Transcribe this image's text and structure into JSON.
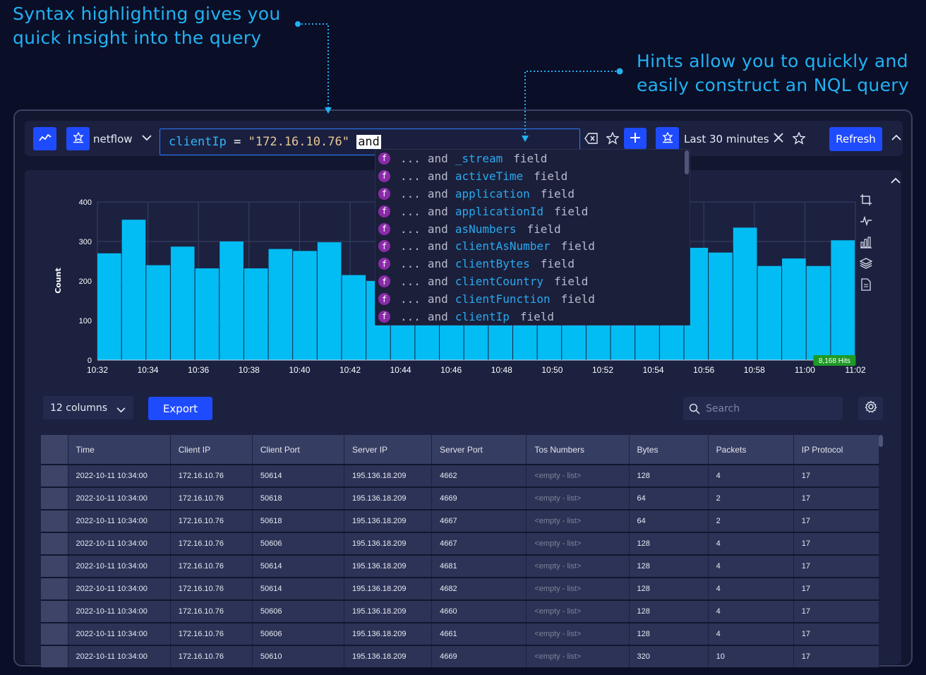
{
  "annotations": {
    "left_line1": "Syntax highlighting gives you",
    "left_line2": "quick insight into the query",
    "right_line1": "Hints allow you to quickly and",
    "right_line2": "easily construct an NQL query"
  },
  "toolbar": {
    "source": "netflow",
    "query": {
      "field": "clientIp",
      "operator": "=",
      "value": "\"172.16.10.76\"",
      "cursor_token": "and"
    },
    "time_range": "Last 30 minutes",
    "refresh_label": "Refresh"
  },
  "autocomplete": {
    "prefix": "...",
    "keyword": "and",
    "type_label": "field",
    "icon_letter": "f",
    "items": [
      "_stream",
      "activeTime",
      "application",
      "applicationId",
      "asNumbers",
      "clientAsNumber",
      "clientBytes",
      "clientCountry",
      "clientFunction",
      "clientIp"
    ]
  },
  "chart_data": {
    "type": "bar",
    "ylabel": "Count",
    "ylim": [
      0,
      400
    ],
    "yticks": [
      0,
      100,
      200,
      300,
      400
    ],
    "xticks": [
      "10:32",
      "10:34",
      "10:36",
      "10:38",
      "10:40",
      "10:42",
      "10:44",
      "10:46",
      "10:48",
      "10:50",
      "10:52",
      "10:54",
      "10:56",
      "10:58",
      "11:00",
      "11:02"
    ],
    "values": [
      270,
      355,
      240,
      287,
      232,
      300,
      232,
      281,
      276,
      298,
      215,
      200,
      200,
      200,
      200,
      200,
      200,
      200,
      200,
      200,
      200,
      200,
      200,
      200,
      284,
      272,
      335,
      238,
      257,
      238,
      303
    ],
    "hits_badge": "8,168 Hits",
    "color": "#02bdf4"
  },
  "controls": {
    "columns_label": "12 columns",
    "export_label": "Export",
    "search_placeholder": "Search"
  },
  "table": {
    "headers": [
      "Time",
      "Client IP",
      "Client Port",
      "Server IP",
      "Server Port",
      "Tos Numbers",
      "Bytes",
      "Packets",
      "IP Protocol"
    ],
    "rows": [
      [
        "2022-10-11 10:34:00",
        "172.16.10.76",
        "50614",
        "195.136.18.209",
        "4662",
        "<empty - list>",
        "128",
        "4",
        "17"
      ],
      [
        "2022-10-11 10:34:00",
        "172.16.10.76",
        "50618",
        "195.136.18.209",
        "4669",
        "<empty - list>",
        "64",
        "2",
        "17"
      ],
      [
        "2022-10-11 10:34:00",
        "172.16.10.76",
        "50618",
        "195.136.18.209",
        "4667",
        "<empty - list>",
        "64",
        "2",
        "17"
      ],
      [
        "2022-10-11 10:34:00",
        "172.16.10.76",
        "50606",
        "195.136.18.209",
        "4667",
        "<empty - list>",
        "128",
        "4",
        "17"
      ],
      [
        "2022-10-11 10:34:00",
        "172.16.10.76",
        "50614",
        "195.136.18.209",
        "4681",
        "<empty - list>",
        "128",
        "4",
        "17"
      ],
      [
        "2022-10-11 10:34:00",
        "172.16.10.76",
        "50614",
        "195.136.18.209",
        "4682",
        "<empty - list>",
        "128",
        "4",
        "17"
      ],
      [
        "2022-10-11 10:34:00",
        "172.16.10.76",
        "50606",
        "195.136.18.209",
        "4660",
        "<empty - list>",
        "128",
        "4",
        "17"
      ],
      [
        "2022-10-11 10:34:00",
        "172.16.10.76",
        "50606",
        "195.136.18.209",
        "4661",
        "<empty - list>",
        "128",
        "4",
        "17"
      ],
      [
        "2022-10-11 10:34:00",
        "172.16.10.76",
        "50610",
        "195.136.18.209",
        "4669",
        "<empty - list>",
        "320",
        "10",
        "17"
      ]
    ]
  }
}
